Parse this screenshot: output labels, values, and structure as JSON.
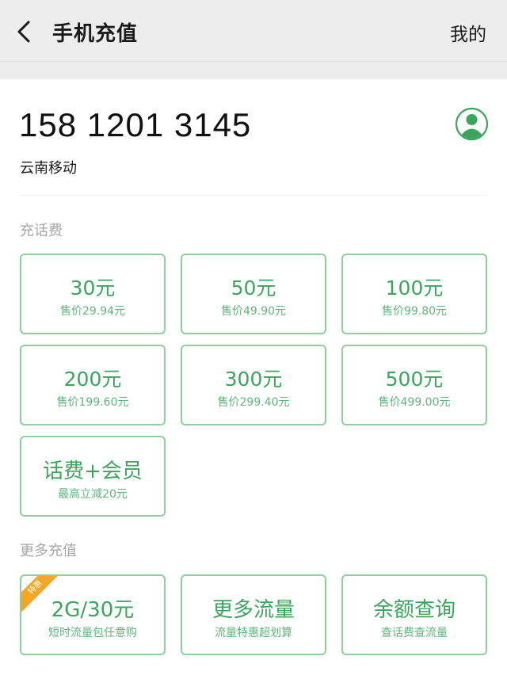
{
  "header": {
    "title": "手机充值",
    "right_link": "我的"
  },
  "account": {
    "phone": "158 1201 3145",
    "carrier": "云南移动"
  },
  "sections": {
    "recharge_label": "充话费",
    "more_label": "更多充值"
  },
  "recharge_options": [
    {
      "amount": "30元",
      "price": "售价29.94元"
    },
    {
      "amount": "50元",
      "price": "售价49.90元"
    },
    {
      "amount": "100元",
      "price": "售价99.80元"
    },
    {
      "amount": "200元",
      "price": "售价199.60元"
    },
    {
      "amount": "300元",
      "price": "售价299.40元"
    },
    {
      "amount": "500元",
      "price": "售价499.00元"
    },
    {
      "amount": "话费+会员",
      "price": "最高立减20元"
    }
  ],
  "more_options": [
    {
      "title": "2G/30元",
      "desc": "短时流量包任意购",
      "badge": "特惠"
    },
    {
      "title": "更多流量",
      "desc": "流量特惠超划算"
    },
    {
      "title": "余额查询",
      "desc": "查话费查流量"
    }
  ],
  "colors": {
    "accent_green": "#3ba55d",
    "card_border": "#8fcf9f",
    "badge_orange": "#f5a623",
    "header_bg": "#ededed"
  }
}
